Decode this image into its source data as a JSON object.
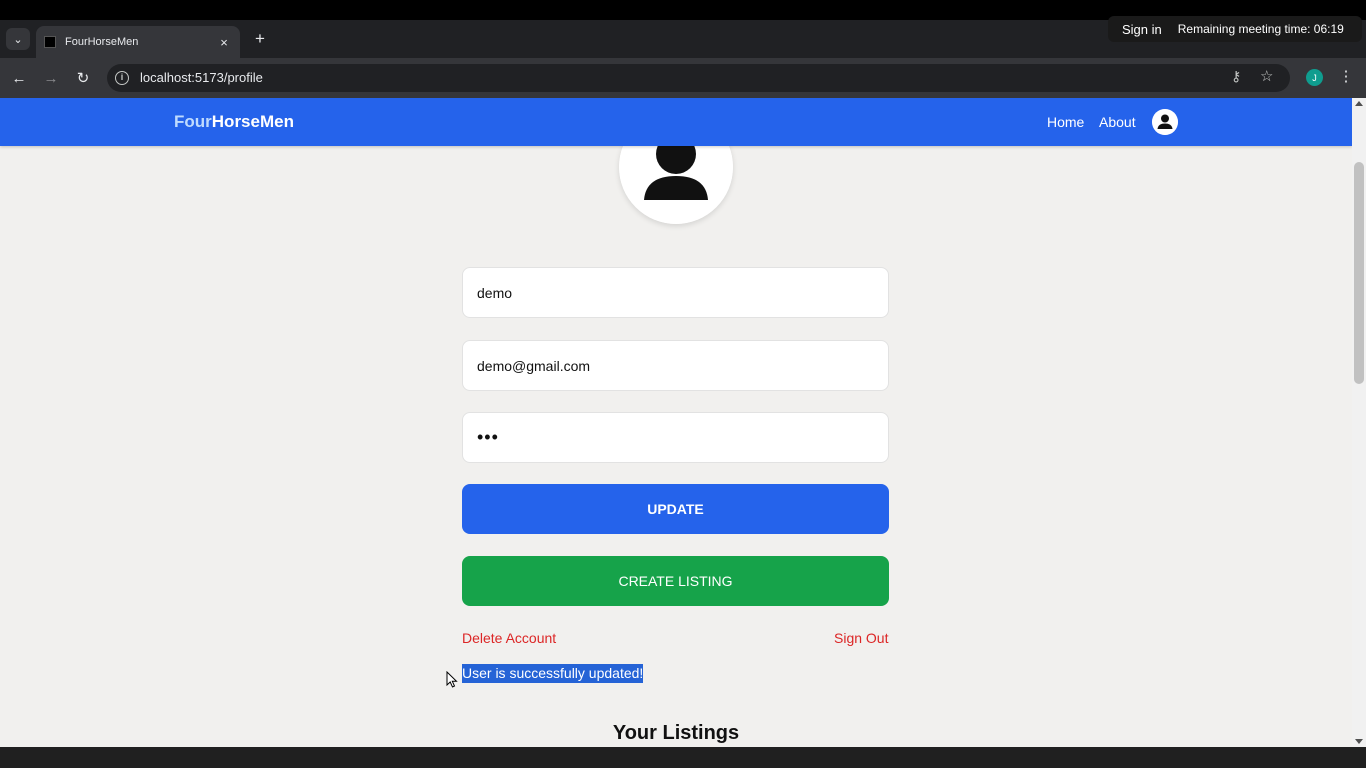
{
  "browser": {
    "tab_title": "FourHorseMen",
    "tab_close": "×",
    "new_tab": "+",
    "tab_list": "⌄",
    "url": "localhost:5173/profile",
    "profile_initial": "J"
  },
  "meeting_overlay": {
    "sign_in": "Sign in",
    "timer": "Remaining meeting time: 06:19"
  },
  "header": {
    "brand_part1": "Four",
    "brand_part2": "HorseMen",
    "nav": {
      "home": "Home",
      "about": "About"
    }
  },
  "profile_form": {
    "username": "demo",
    "email": "demo@gmail.com",
    "password_mask": "•••",
    "update_label": "UPDATE",
    "create_listing_label": "CREATE LISTING",
    "delete_account": "Delete Account",
    "sign_out": "Sign Out",
    "success_message": "User is successfully updated!"
  },
  "listings": {
    "title": "Your Listings"
  },
  "colors": {
    "brand_blue": "#2563eb",
    "create_green": "#16a34a",
    "danger_red": "#dc2626",
    "page_bg": "#f1f0ee"
  }
}
